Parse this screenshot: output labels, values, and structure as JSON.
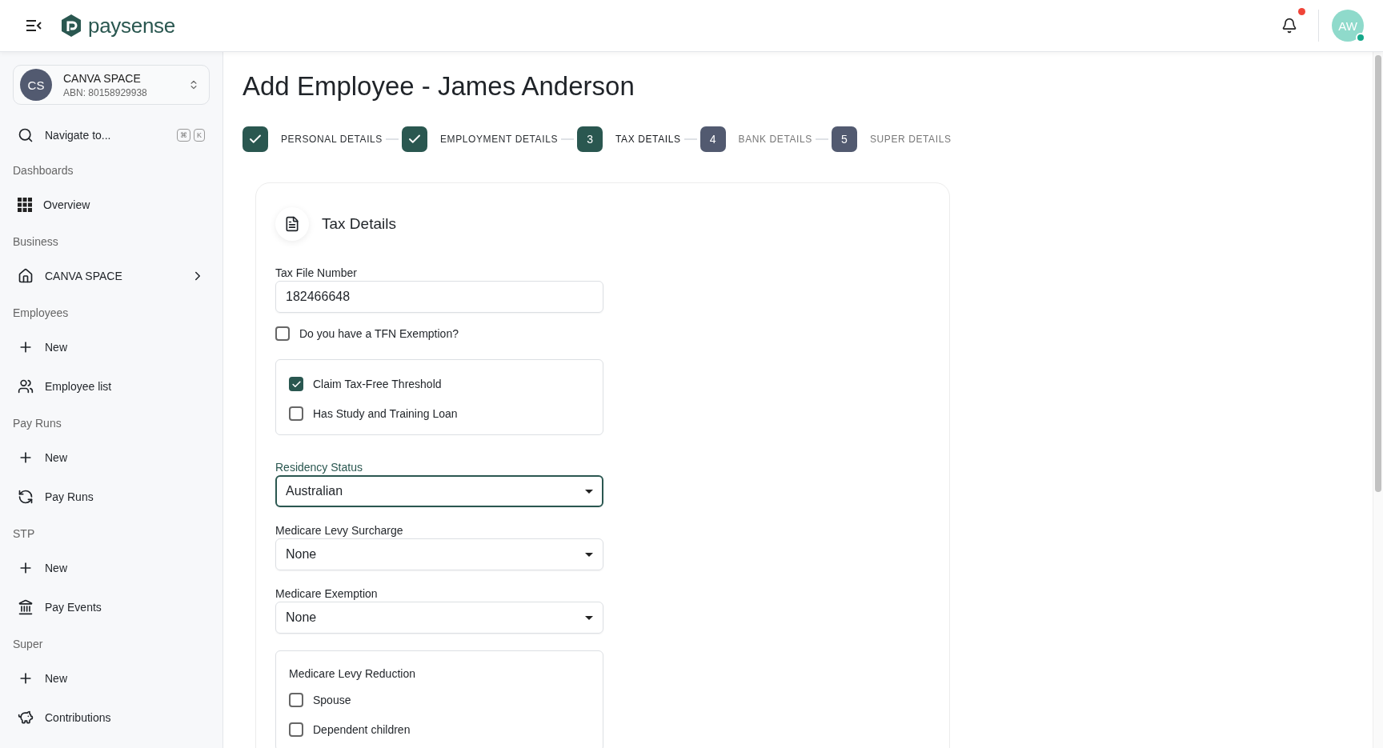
{
  "header": {
    "logo": "paysense",
    "notification": {
      "unread": true
    },
    "avatar": {
      "initials": "AW",
      "online": true
    }
  },
  "sidebar": {
    "account": {
      "initials": "CS",
      "name": "CANVA SPACE",
      "abn": "ABN: 80158929938"
    },
    "search": {
      "placeholder": "Navigate to...",
      "keys": [
        "⌘",
        "K"
      ]
    },
    "sections": [
      {
        "title": "Dashboards",
        "items": [
          {
            "label": "Overview",
            "chevron": false
          }
        ]
      },
      {
        "title": "Business",
        "items": [
          {
            "label": "CANVA SPACE",
            "chevron": true
          }
        ]
      },
      {
        "title": "Employees",
        "items": [
          {
            "label": "New",
            "chevron": false
          },
          {
            "label": "Employee list",
            "chevron": false
          }
        ]
      },
      {
        "title": "Pay Runs",
        "items": [
          {
            "label": "New",
            "chevron": false
          },
          {
            "label": "Pay Runs",
            "chevron": false
          }
        ]
      },
      {
        "title": "STP",
        "items": [
          {
            "label": "New",
            "chevron": false
          },
          {
            "label": "Pay Events",
            "chevron": false
          }
        ]
      },
      {
        "title": "Super",
        "items": [
          {
            "label": "New",
            "chevron": false
          },
          {
            "label": "Contributions",
            "chevron": false
          }
        ]
      }
    ]
  },
  "page": {
    "title": "Add Employee - James Anderson"
  },
  "steps": [
    {
      "label": "PERSONAL DETAILS",
      "completed": true,
      "current": false
    },
    {
      "label": "EMPLOYMENT DETAILS",
      "completed": true,
      "current": false
    },
    {
      "number": "3",
      "label": "TAX DETAILS",
      "completed": false,
      "current": true
    },
    {
      "number": "4",
      "label": "BANK DETAILS",
      "completed": false,
      "current": false
    },
    {
      "number": "5",
      "label": "SUPER DETAILS",
      "completed": false,
      "current": false
    }
  ],
  "form": {
    "title": "Tax Details",
    "items": [
      {
        "kind": "input",
        "label": "Tax File Number",
        "value": "182466648"
      },
      {
        "kind": "checkbox",
        "label": "Do you have a TFN Exemption?",
        "checked": false
      },
      {
        "kind": "group",
        "checkboxes": [
          {
            "label": "Claim Tax-Free Threshold",
            "checked": true
          },
          {
            "label": "Has Study and Training Loan",
            "checked": false
          }
        ]
      },
      {
        "kind": "select",
        "label": "Residency Status",
        "value": "Australian",
        "focused": true
      },
      {
        "kind": "select",
        "label": "Medicare Levy Surcharge",
        "value": "None",
        "focused": false
      },
      {
        "kind": "select",
        "label": "Medicare Exemption",
        "value": "None",
        "focused": false
      },
      {
        "kind": "group",
        "title": "Medicare Levy Reduction",
        "checkboxes": [
          {
            "label": "Spouse",
            "checked": false
          },
          {
            "label": "Dependent children",
            "checked": false
          }
        ]
      }
    ]
  }
}
